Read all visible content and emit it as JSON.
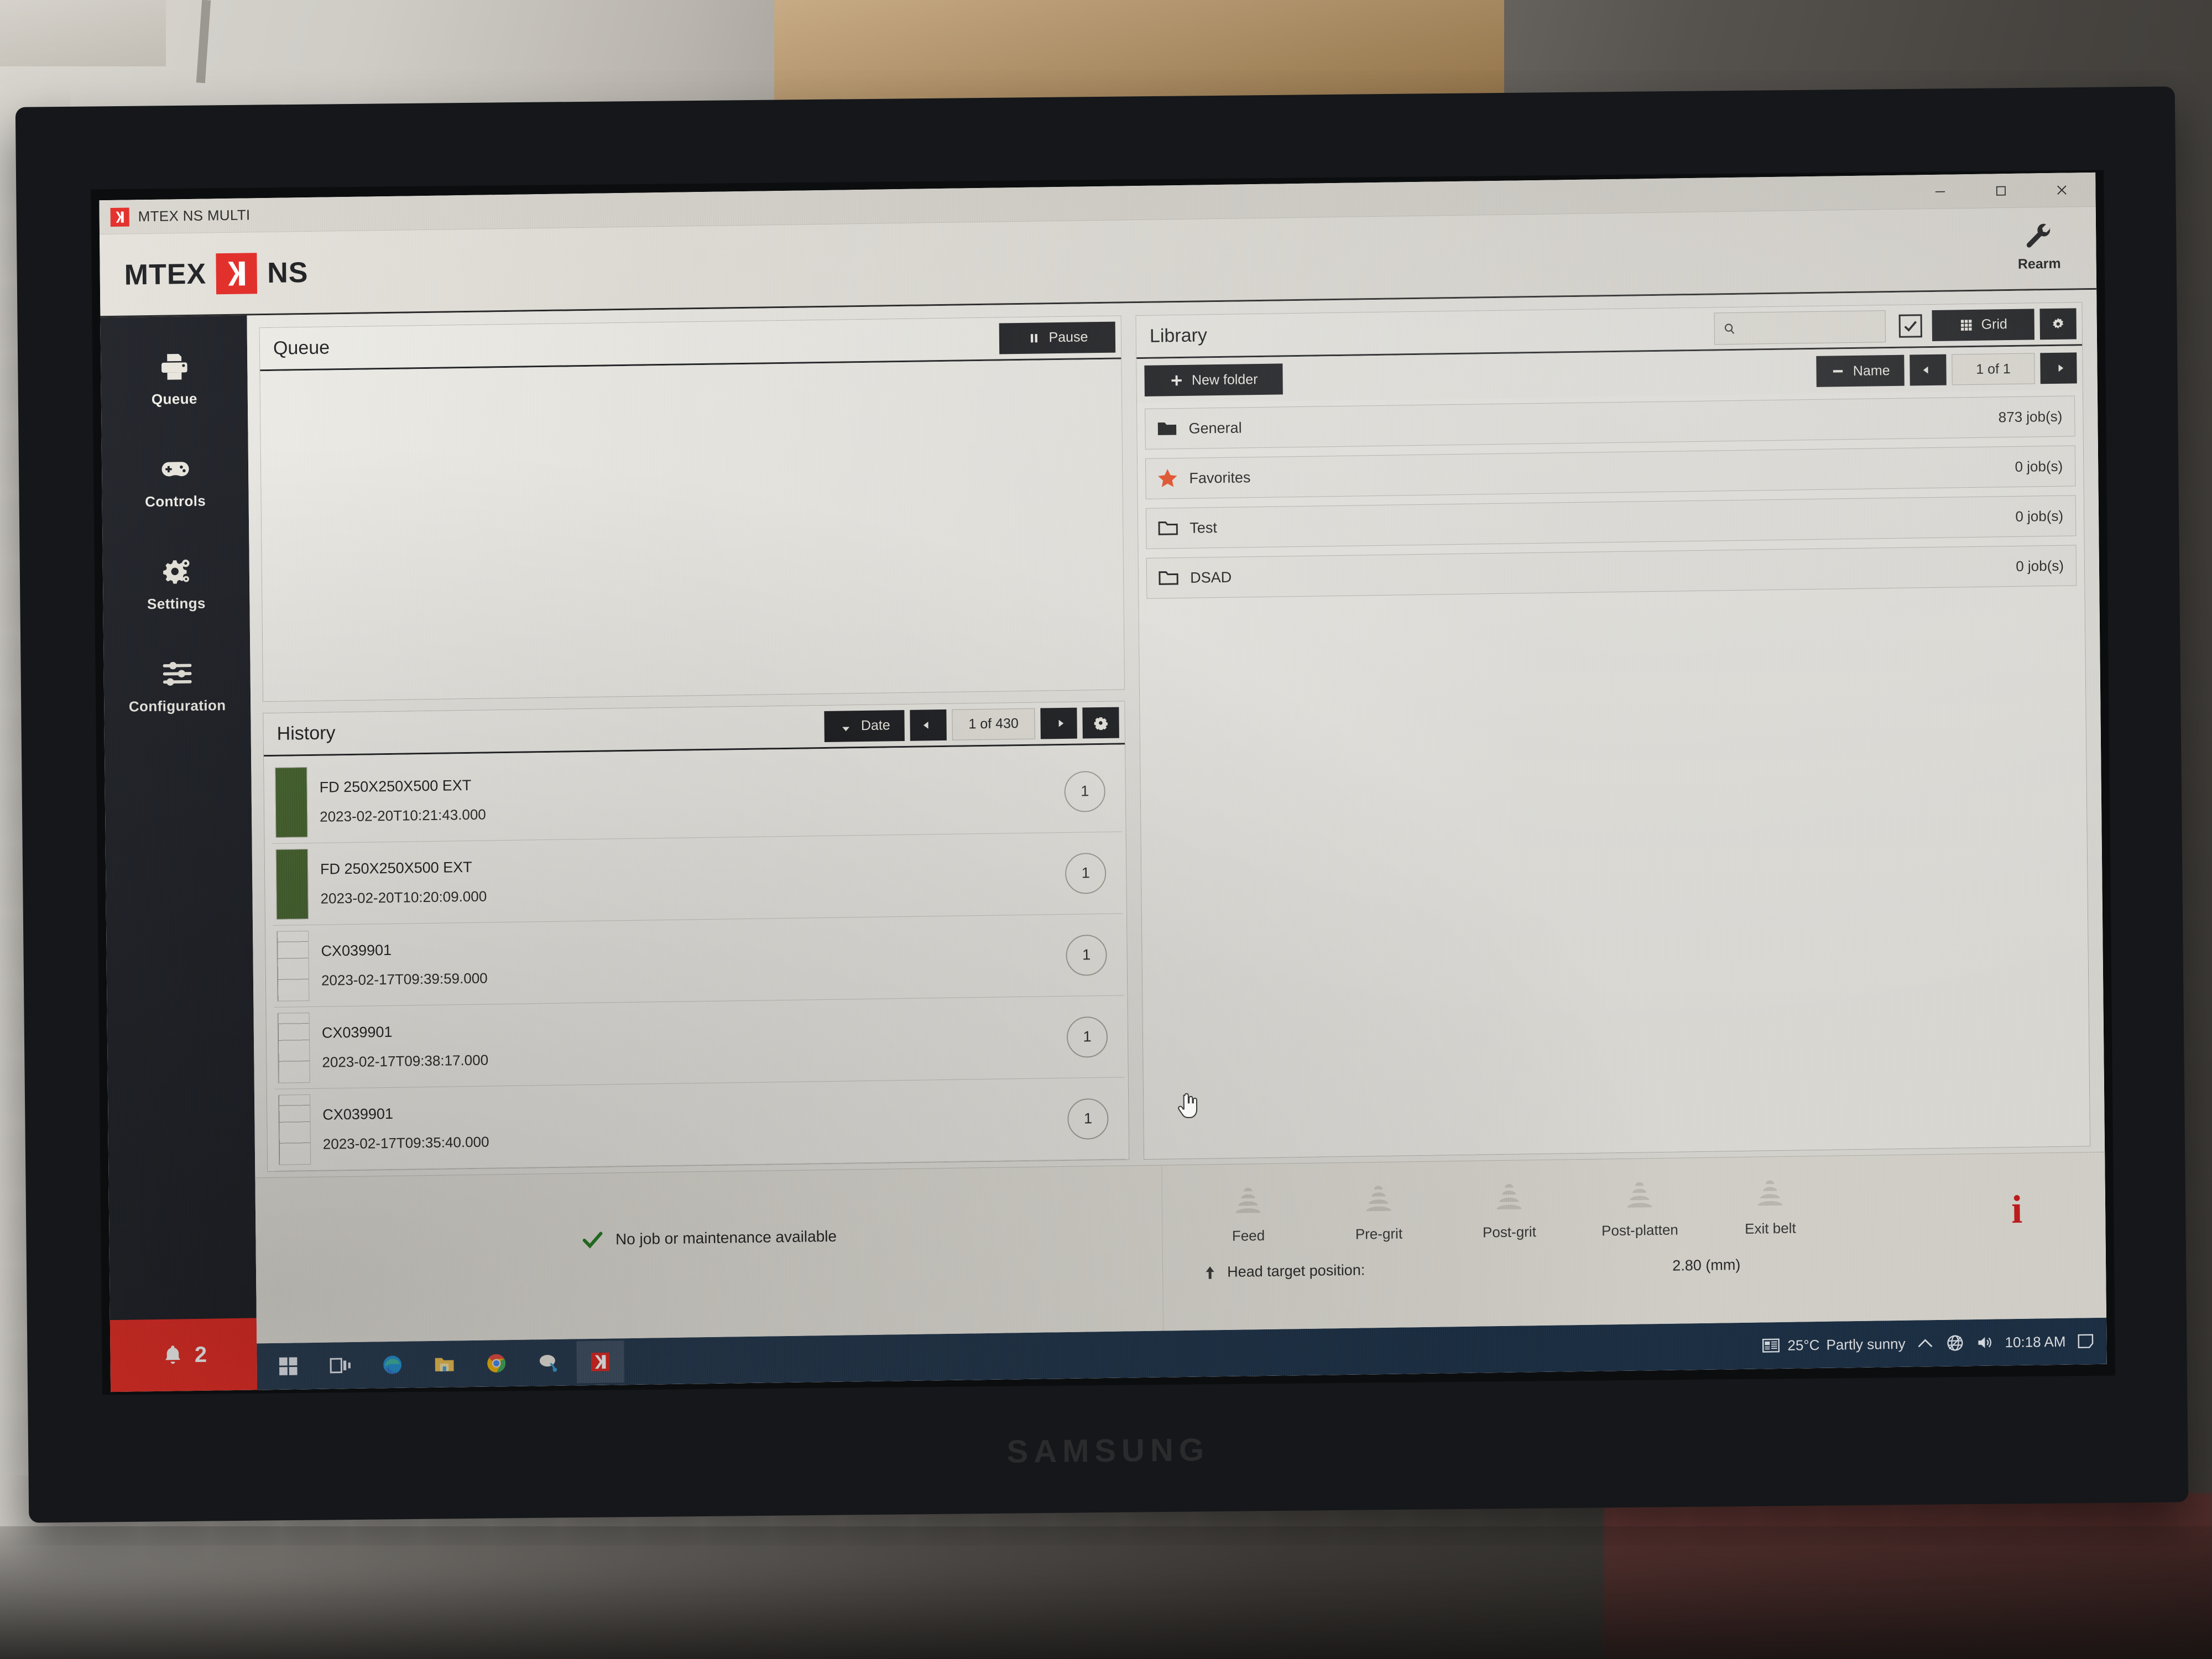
{
  "window": {
    "title": "MTEX NS MULTI",
    "logo_icon": "mtex-logo-icon",
    "minimize_icon": "minimize-icon",
    "maximize_icon": "maximize-icon",
    "close_icon": "close-icon"
  },
  "header": {
    "brand_left": "MTEX",
    "brand_right": "NS",
    "brand_mark_icon": "mtex-mark-icon",
    "rearm": {
      "label": "Rearm",
      "icon": "wrench-icon"
    }
  },
  "sidebar": {
    "items": [
      {
        "label": "Queue",
        "icon": "printer-icon"
      },
      {
        "label": "Controls",
        "icon": "gamepad-icon"
      },
      {
        "label": "Settings",
        "icon": "gears-icon"
      },
      {
        "label": "Configuration",
        "icon": "sliders-icon"
      }
    ],
    "alert": {
      "icon": "bell-icon",
      "count": "2"
    }
  },
  "queue": {
    "title": "Queue",
    "pause_label": "Pause",
    "pause_icon": "pause-icon"
  },
  "history": {
    "title": "History",
    "sort_label": "Date",
    "sort_icon": "arrow-down-icon",
    "prev_icon": "arrow-left-icon",
    "next_icon": "arrow-right-icon",
    "settings_icon": "gear-icon",
    "page_indicator": "1 of 430",
    "rows": [
      {
        "name": "FD 250X250X500 EXT",
        "date": "2023-02-20T10:21:43.000",
        "count": "1",
        "thumb": "green"
      },
      {
        "name": "FD 250X250X500 EXT",
        "date": "2023-02-20T10:20:09.000",
        "count": "1",
        "thumb": "green"
      },
      {
        "name": "CX039901",
        "date": "2023-02-17T09:39:59.000",
        "count": "1",
        "thumb": "doc"
      },
      {
        "name": "CX039901",
        "date": "2023-02-17T09:38:17.000",
        "count": "1",
        "thumb": "doc"
      },
      {
        "name": "CX039901",
        "date": "2023-02-17T09:35:40.000",
        "count": "1",
        "thumb": "doc"
      }
    ]
  },
  "library": {
    "title": "Library",
    "search_placeholder": "",
    "search_value": "",
    "search_icon": "search-icon",
    "select_all_icon": "checkbox-checked-icon",
    "view_label": "Grid",
    "view_icon": "grid-icon",
    "settings_icon": "gear-icon",
    "new_folder_label": "New folder",
    "new_folder_icon": "plus-icon",
    "sort_label": "Name",
    "sort_icon": "minus-icon",
    "prev_icon": "arrow-left-icon",
    "next_icon": "arrow-right-icon",
    "page_indicator": "1 of 1",
    "folders": [
      {
        "name": "General",
        "count": "873 job(s)",
        "icon": "folder-filled-icon"
      },
      {
        "name": "Favorites",
        "count": "0 job(s)",
        "icon": "star-icon"
      },
      {
        "name": "Test",
        "count": "0 job(s)",
        "icon": "folder-outline-icon"
      },
      {
        "name": "DSAD",
        "count": "0 job(s)",
        "icon": "folder-outline-icon"
      }
    ]
  },
  "status": {
    "message": "No job or maintenance available",
    "message_icon": "check-icon",
    "stations": [
      {
        "label": "Feed",
        "icon": "station-arc-icon"
      },
      {
        "label": "Pre-grit",
        "icon": "station-arc-icon"
      },
      {
        "label": "Post-grit",
        "icon": "station-arc-icon"
      },
      {
        "label": "Post-platten",
        "icon": "station-arc-icon"
      },
      {
        "label": "Exit belt",
        "icon": "station-arc-icon"
      }
    ],
    "head_target_label": "Head target position:",
    "head_target_icon": "arrow-up-icon",
    "head_target_value": "2.80 (mm)",
    "info_icon": "info-icon",
    "info_glyph": "i"
  },
  "taskbar": {
    "items": [
      {
        "icon": "windows-start-icon"
      },
      {
        "icon": "task-view-icon"
      },
      {
        "icon": "edge-icon"
      },
      {
        "icon": "file-explorer-icon"
      },
      {
        "icon": "chrome-icon"
      },
      {
        "icon": "app-icon"
      },
      {
        "icon": "mtex-taskbar-icon"
      }
    ],
    "tray": {
      "news_icon": "news-weather-icon",
      "temperature": "25°C",
      "weather": "Partly sunny",
      "chevron_icon": "chevron-up-icon",
      "network_icon": "network-globe-icon",
      "volume_icon": "speaker-icon",
      "clock": "10:18 AM",
      "notification_icon": "notification-icon"
    }
  },
  "monitor": {
    "brand": "SAMSUNG"
  }
}
